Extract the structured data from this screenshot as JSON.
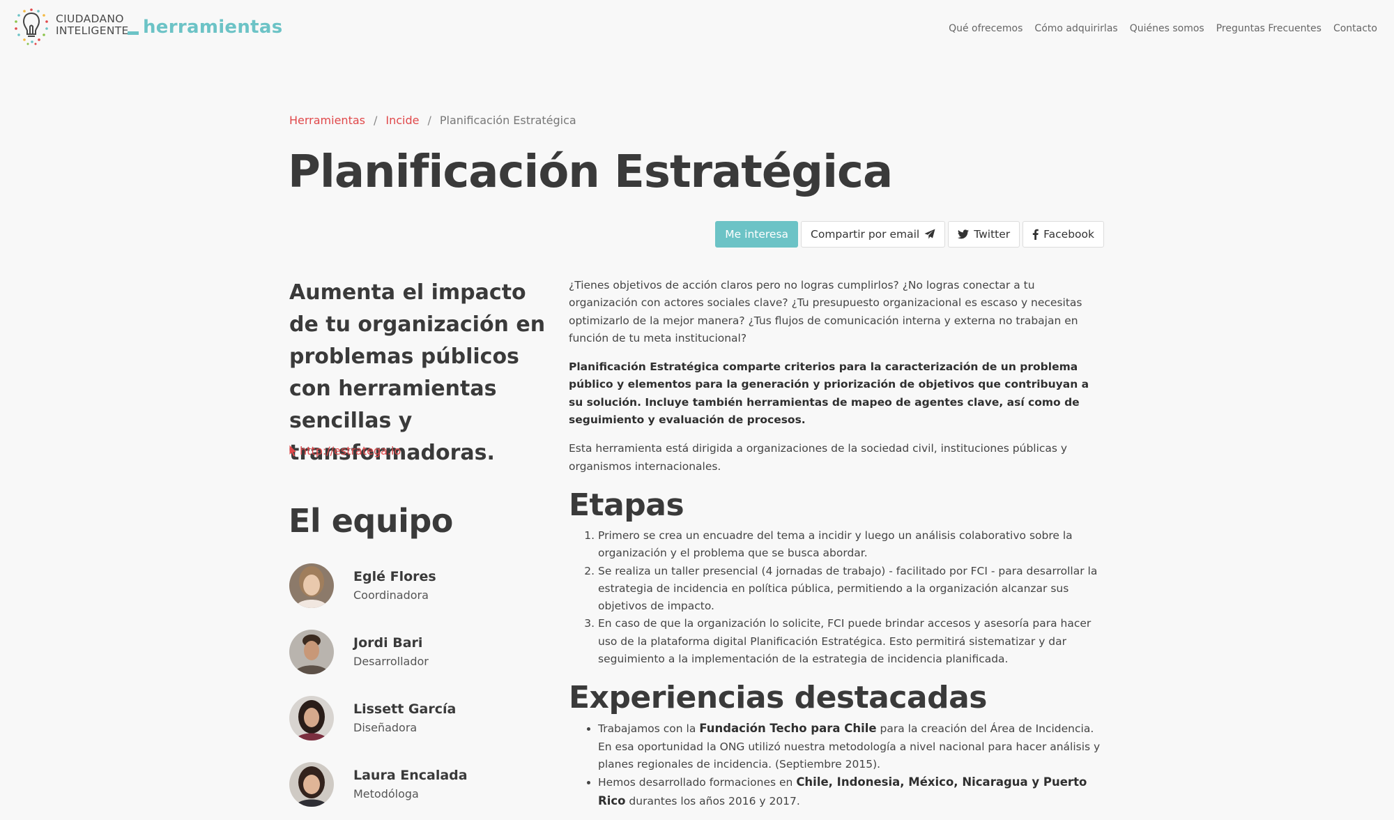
{
  "nav": {
    "brand_top": "CIUDADANO",
    "brand_bottom": "INTELIGENTE",
    "brand_tools": "herramientas",
    "links": [
      "Qué ofrecemos",
      "Cómo adquirirlas",
      "Quiénes somos",
      "Preguntas Frecuentes",
      "Contacto"
    ]
  },
  "breadcrumb": {
    "items": [
      "Herramientas",
      "Incide",
      "Planificación Estratégica"
    ],
    "separator": "/"
  },
  "title": "Planificación Estratégica",
  "actions": {
    "interest": "Me interesa",
    "email": "Compartir por email",
    "twitter": "Twitter",
    "facebook": "Facebook"
  },
  "lead": "Aumenta el impacto de tu organización en problemas públicos con herramientas sencillas y transformadoras.",
  "external_link": "http://estratega.io",
  "team": {
    "title": "El equipo",
    "members": [
      {
        "name": "Eglé Flores",
        "role": "Coordinadora"
      },
      {
        "name": "Jordi Bari",
        "role": "Desarrollador"
      },
      {
        "name": "Lissett García",
        "role": "Diseñadora"
      },
      {
        "name": "Laura Encalada",
        "role": "Metodóloga"
      }
    ]
  },
  "body": {
    "intro": "¿Tienes objetivos de acción claros pero no logras cumplirlos? ¿No logras conectar a tu organización con actores sociales clave? ¿Tu presupuesto organizacional es escaso y necesitas optimizarlo de la mejor manera? ¿Tus flujos de comunicación interna y externa no trabajan en función de tu meta institucional?",
    "summary": "Planificación Estratégica comparte criterios para la caracterización de un problema público y elementos para la generación y priorización de objetivos que contribuyan a su solución. Incluye también herramientas de mapeo de agentes clave, así como de seguimiento y evaluación de procesos.",
    "audience": "Esta herramienta está dirigida a organizaciones de la sociedad civil, instituciones públicas y organismos internacionales.",
    "stages_title": "Etapas",
    "stages": [
      "Primero se crea un encuadre del tema a incidir y luego un análisis colaborativo sobre la organización y el problema que se busca abordar.",
      "Se realiza un taller presencial (4 jornadas de trabajo) - facilitado por FCI - para desarrollar la estrategia de incidencia en política pública, permitiendo a la organización alcanzar sus objetivos de impacto.",
      "En caso de que la organización lo solicite, FCI puede brindar accesos y asesoría para hacer uso de la plataforma digital Planificación Estratégica. Esto permitirá sistematizar y dar seguimiento a la implementación de la estrategia de incidencia planificada."
    ],
    "experiences_title": "Experiencias destacadas",
    "experiences": [
      {
        "before": "Trabajamos con la ",
        "bold": "Fundación Techo para Chile",
        "after": " para la creación del Área de Incidencia. En esa oportunidad la ONG utilizó nuestra metodología a nivel nacional para hacer análisis y planes regionales de incidencia. (Septiembre 2015)."
      },
      {
        "before": "Hemos desarrollado formaciones en ",
        "bold": "Chile, Indonesia, México, Nicaragua y Puerto Rico",
        "after": " durantes los años 2016 y 2017."
      }
    ]
  },
  "colors": {
    "accent": "#6cc3c6",
    "link": "#e0484a",
    "background": "#f8f8f8"
  },
  "icons": [
    "lightbulb-logo-icon",
    "paper-plane-icon",
    "twitter-bird-icon",
    "facebook-f-icon",
    "cursor-pointer-icon"
  ]
}
